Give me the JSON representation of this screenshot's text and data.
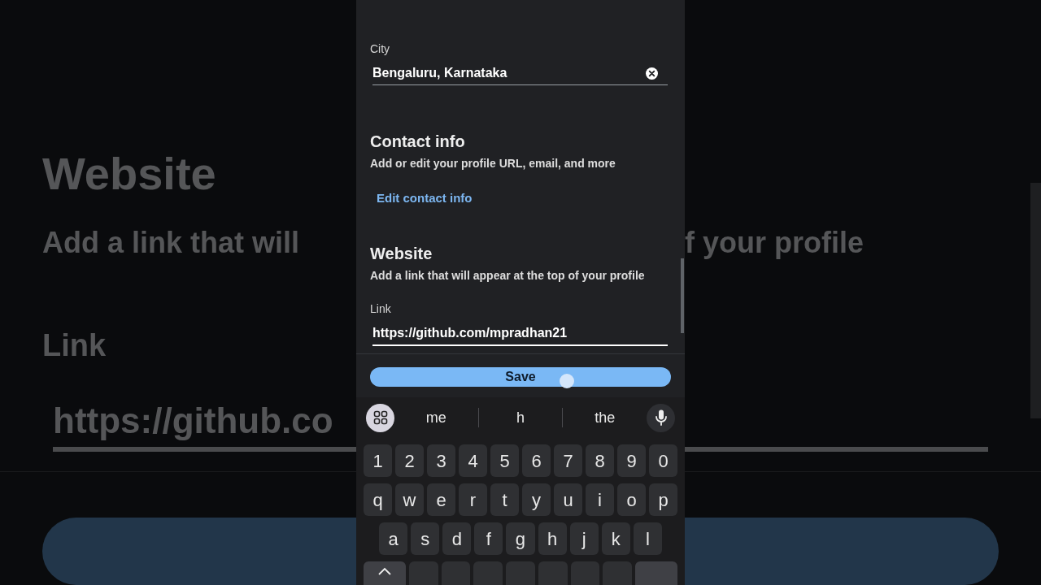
{
  "backdrop": {
    "heading": "Website",
    "description_start": "Add a link that will",
    "description_end": "f your profile",
    "link_label": "Link",
    "link_value": "https://github.co"
  },
  "city": {
    "label": "City",
    "value": "Bengaluru, Karnataka",
    "focused": false
  },
  "contact_info": {
    "title": "Contact info",
    "description": "Add or edit your profile URL, email, and more",
    "link": "Edit contact info"
  },
  "website": {
    "title": "Website",
    "description": "Add a link that will appear at the top of your profile",
    "field": {
      "label": "Link",
      "value": "https://github.com/mpradhan21",
      "focused": true
    }
  },
  "save_button": "Save",
  "keyboard": {
    "suggestions": [
      "me",
      "h",
      "the"
    ],
    "rows": [
      [
        "1",
        "2",
        "3",
        "4",
        "5",
        "6",
        "7",
        "8",
        "9",
        "0"
      ],
      [
        "q",
        "w",
        "e",
        "r",
        "t",
        "y",
        "u",
        "i",
        "o",
        "p"
      ],
      [
        "a",
        "s",
        "d",
        "f",
        "g",
        "h",
        "j",
        "k",
        "l"
      ]
    ]
  }
}
